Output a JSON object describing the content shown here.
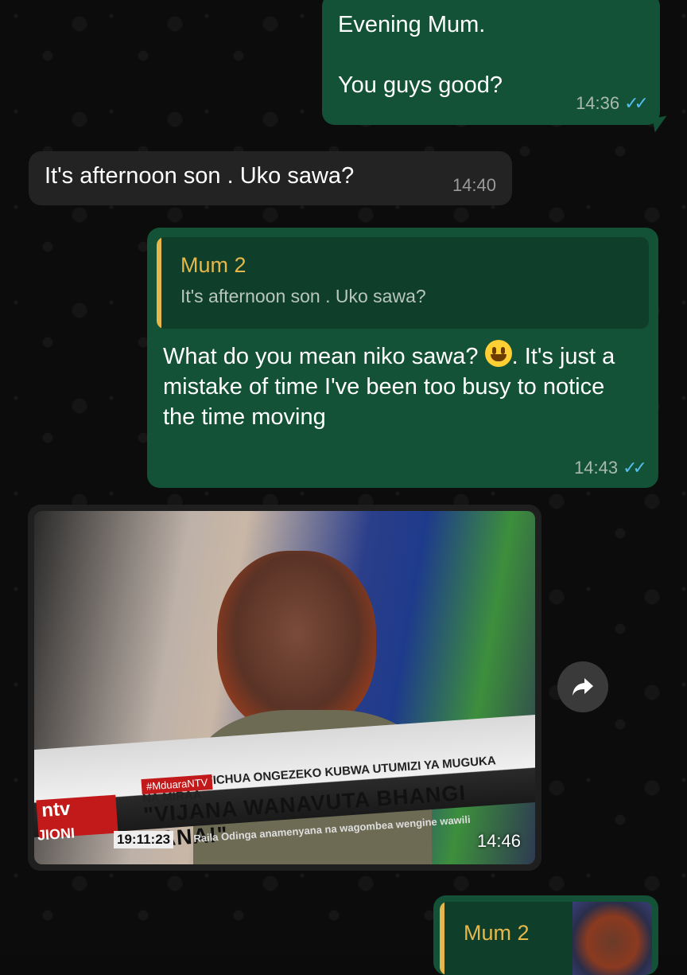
{
  "messages": [
    {
      "id": "m1",
      "direction": "outgoing",
      "line1": "Evening Mum.",
      "line2": "You guys good?",
      "time": "14:36",
      "status": "read"
    },
    {
      "id": "m2",
      "direction": "incoming",
      "text": "It's afternoon son . Uko sawa?",
      "time": "14:40"
    },
    {
      "id": "m3",
      "direction": "outgoing",
      "reply_to": {
        "name": "Mum 2",
        "text": "It's afternoon son . Uko sawa?"
      },
      "text_before_emoji": "What do you mean niko sawa? ",
      "emoji": "smiley",
      "text_after_emoji": ". It's just a mistake of time I've been too busy to notice the time moving",
      "time": "14:43",
      "status": "read"
    },
    {
      "id": "m4",
      "direction": "incoming",
      "type": "image",
      "time": "14:46",
      "image_overlay": {
        "tag": "#MduaraNTV",
        "subtitle": "RIPOTI IMEFICHUA ONGEZEKO KUBWA UTUMIZI YA MUGUKA NA MIRAA",
        "headline": "\"VIJANA WANAVUTA BHANGI SANA!\"",
        "ticker": "Raila Odinga anamenyana na wagombea wengine wawili",
        "clock": "19:11:23",
        "logo": "ntv",
        "logo_sub": "JIONI"
      }
    },
    {
      "id": "m5",
      "direction": "outgoing",
      "reply_to": {
        "name": "Mum 2"
      }
    }
  ],
  "colors": {
    "outgoing_bubble": "#135236",
    "incoming_bubble": "#232323",
    "read_ticks": "#53bdeb",
    "quote_accent": "#e6b74a"
  },
  "icons": {
    "forward": "forward-arrow-icon",
    "read": "double-check-icon"
  }
}
